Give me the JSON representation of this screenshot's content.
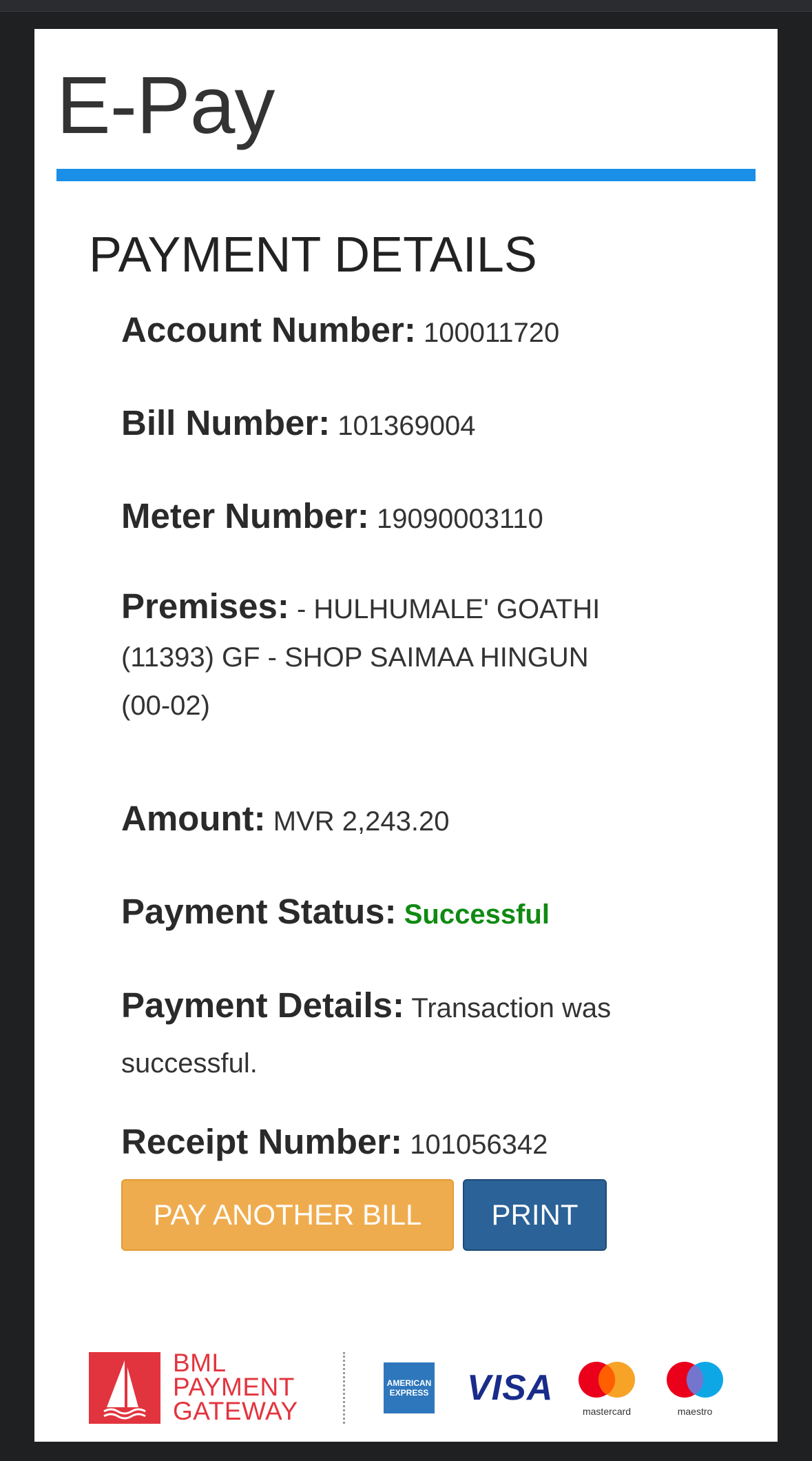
{
  "app": {
    "title": "E-Pay"
  },
  "section": {
    "heading": "PAYMENT DETAILS"
  },
  "fields": {
    "account_number": {
      "label": "Account Number:",
      "value": "100011720"
    },
    "bill_number": {
      "label": "Bill Number:",
      "value": "101369004"
    },
    "meter_number": {
      "label": "Meter Number:",
      "value": "19090003110"
    },
    "premises": {
      "label": "Premises:",
      "value": "- HULHUMALE' GOATHI (11393) GF - SHOP SAIMAA HINGUN (00-02)"
    },
    "amount": {
      "label": "Amount:",
      "value": "MVR 2,243.20"
    },
    "payment_status": {
      "label": "Payment Status:",
      "value": "Successful",
      "color": "#0f8a12"
    },
    "payment_details": {
      "label": "Payment Details:",
      "value": "Transaction was successful."
    },
    "receipt_number": {
      "label": "Receipt Number:",
      "value": "101056342"
    }
  },
  "actions": {
    "pay_another_bill": "PAY ANOTHER BILL",
    "print": "PRINT"
  },
  "footer": {
    "gateway_name_line1": "BML",
    "gateway_name_line2": "PAYMENT",
    "gateway_name_line3": "GATEWAY",
    "amex_text": "AMERICAN EXPRESS",
    "visa_text": "VISA",
    "mastercard_caption": "mastercard",
    "maestro_caption": "maestro"
  },
  "colors": {
    "accent_bar": "#1a8fe8",
    "success": "#0f8a12",
    "pay_button": "#efac4e",
    "print_button": "#2b6297",
    "bml_red": "#e2343e"
  }
}
